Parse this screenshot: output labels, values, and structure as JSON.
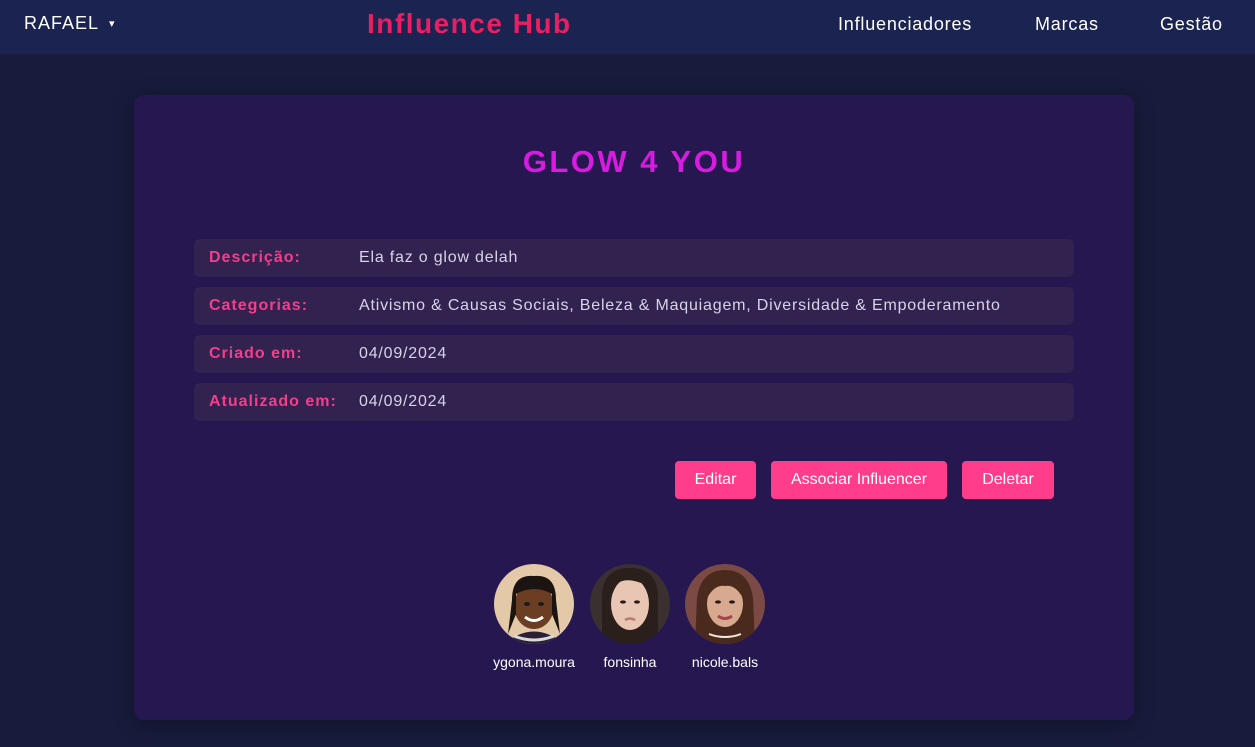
{
  "nav": {
    "user_label": "RAFAEL",
    "user_caret": "▾",
    "brand": "Influence Hub",
    "links": [
      "Influenciadores",
      "Marcas",
      "Gestão"
    ]
  },
  "brand_detail": {
    "title": "GLOW 4 YOU",
    "fields": [
      {
        "label": "Descrição:",
        "value": "Ela faz o glow delah"
      },
      {
        "label": "Categorias:",
        "value": "Ativismo & Causas Sociais, Beleza & Maquiagem, Diversidade & Empoderamento"
      },
      {
        "label": "Criado em:",
        "value": "04/09/2024"
      },
      {
        "label": "Atualizado em:",
        "value": "04/09/2024"
      }
    ]
  },
  "actions": {
    "edit_label": "Editar",
    "associate_label": "Associar Influencer",
    "delete_label": "Deletar"
  },
  "influencers": [
    {
      "name": "ygona.moura"
    },
    {
      "name": "fonsinha"
    },
    {
      "name": "nicole.bals"
    }
  ],
  "colors": {
    "background": "#171c3c",
    "navbar": "#1b2451",
    "accent": "#e91e63",
    "title": "#d81be0",
    "button": "#ff3d8b",
    "card": "#261750",
    "row": "#32224f"
  }
}
